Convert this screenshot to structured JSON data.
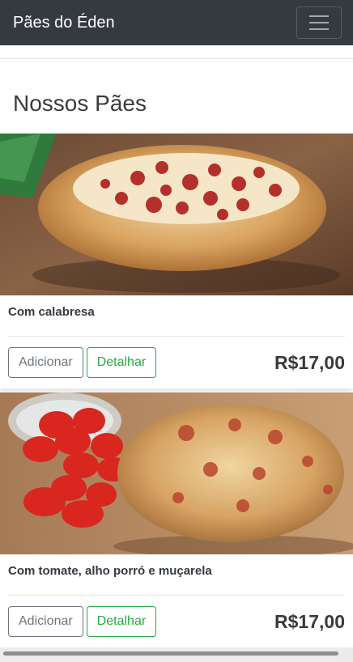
{
  "navbar": {
    "brand": "Pães do Éden",
    "toggler_icon": "hamburger-menu-icon"
  },
  "page": {
    "title": "Nossos Pães"
  },
  "products": [
    {
      "name": "Com calabresa",
      "price": "R$17,00",
      "add_label": "Adicionar",
      "detail_label": "Detalhar"
    },
    {
      "name": "Com tomate, alho porró e muçarela",
      "price": "R$17,00",
      "add_label": "Adicionar",
      "detail_label": "Detalhar"
    }
  ],
  "colors": {
    "navbar_bg": "#343a40",
    "secondary": "#6c757d",
    "success": "#28a745"
  }
}
